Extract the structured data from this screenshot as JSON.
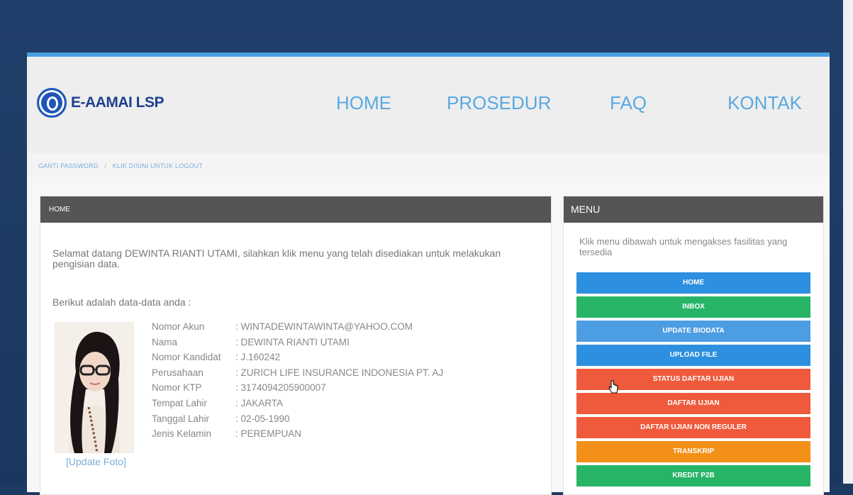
{
  "header": {
    "logo_text": "E-AAMAI LSP",
    "nav": [
      "HOME",
      "PROSEDUR",
      "FAQ",
      "KONTAK"
    ]
  },
  "subnav": {
    "change_password": "GANTI PASSWORD",
    "separator": "/",
    "logout": "KLIK DISINI UNTUK LOGOUT"
  },
  "main_panel": {
    "title": "HOME",
    "welcome": "Selamat datang DEWINTA RIANTI UTAMI, silahkan klik menu yang telah disediakan untuk melakukan pengisian data.",
    "berikut": "Berikut adalah data-data anda :",
    "update_photo": "[Update Foto]",
    "fields": [
      {
        "label": "Nomor Akun",
        "value": ": WINTADEWINTAWINTA@YAHOO.COM"
      },
      {
        "label": "Nama",
        "value": ": DEWINTA RIANTI UTAMI"
      },
      {
        "label": "Nomor Kandidat",
        "value": ": J.160242"
      },
      {
        "label": "Perusahaan",
        "value": ": ZURICH LIFE INSURANCE INDONESIA PT. AJ"
      },
      {
        "label": "Nomor KTP",
        "value": ": 3174094205900007"
      },
      {
        "label": "Tempat Lahir",
        "value": ": JAKARTA"
      },
      {
        "label": "Tanggal Lahir",
        "value": ": 02-05-1990"
      },
      {
        "label": "Jenis Kelamin",
        "value": ": PEREMPUAN"
      }
    ]
  },
  "menu_panel": {
    "title": "MENU",
    "intro": "Klik menu dibawah untuk mengakses fasilitas yang tersedia",
    "buttons": [
      {
        "label": "HOME",
        "color": "#2d8fe0"
      },
      {
        "label": "INBOX",
        "color": "#27b467"
      },
      {
        "label": "UPDATE BIODATA",
        "color": "#4c9de2"
      },
      {
        "label": "UPLOAD FILE",
        "color": "#2d8fe0"
      },
      {
        "label": "STATUS DAFTAR UJIAN",
        "color": "#ef5a3c"
      },
      {
        "label": "DAFTAR UJIAN",
        "color": "#ef5a3c"
      },
      {
        "label": "DAFTAR UJIAN NON REGULER",
        "color": "#ef5a3c"
      },
      {
        "label": "TRANSKRIP",
        "color": "#f29018"
      },
      {
        "label": "KREDIT P2B",
        "color": "#27b467"
      }
    ]
  },
  "colors": {
    "accent": "#4aa0e0",
    "nav_text": "#5aa9e0",
    "panel_header": "#555555",
    "logo": "#1f3f8f"
  },
  "icons": [
    "logo-icon",
    "pointer-cursor-icon"
  ]
}
